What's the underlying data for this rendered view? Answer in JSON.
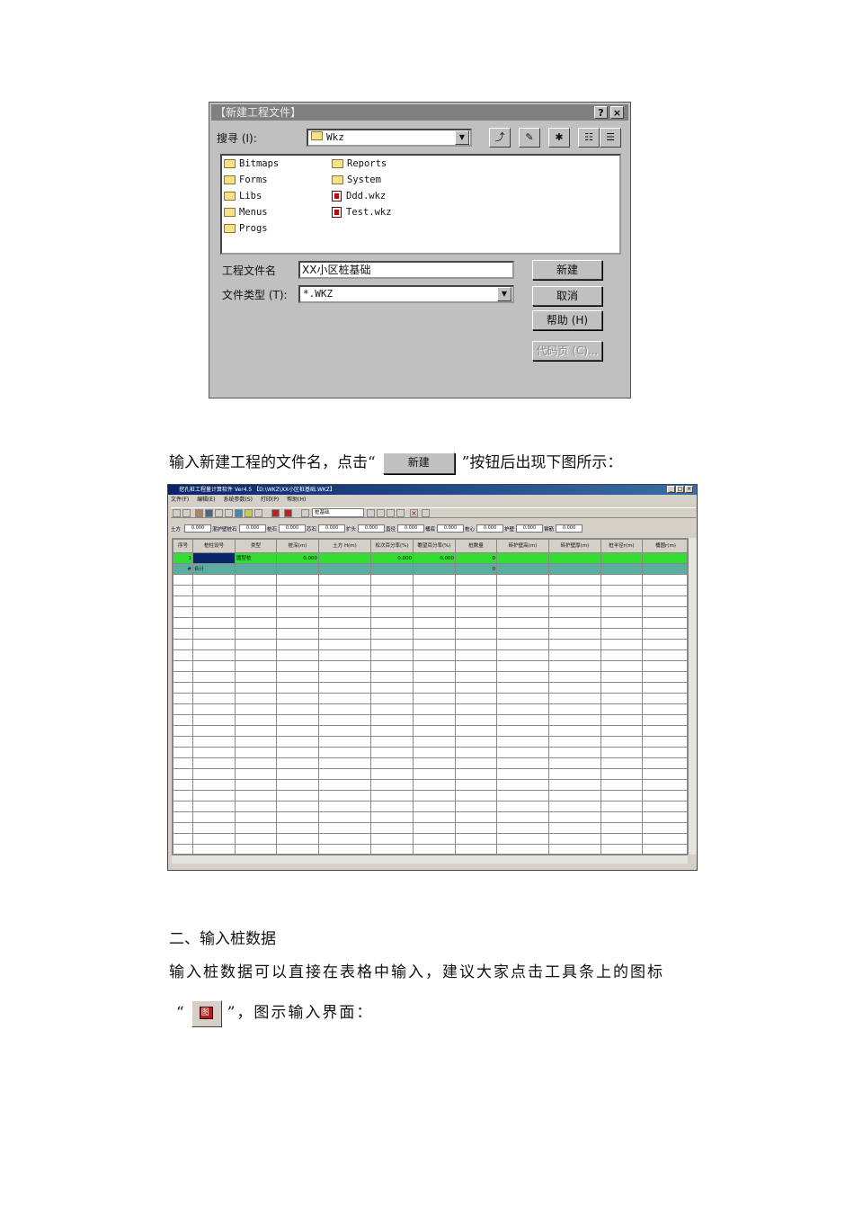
{
  "dialog": {
    "title": "【新建工程文件】",
    "help_btn": "?",
    "close_btn": "×",
    "search_label": "搜寻 (I):",
    "search_folder": "Wkz",
    "files_col1": [
      "Bitmaps",
      "Forms",
      "Libs",
      "Menus",
      "Progs"
    ],
    "files_col2": [
      {
        "name": "Reports",
        "type": "folder"
      },
      {
        "name": "System",
        "type": "folder"
      },
      {
        "name": "Ddd.wkz",
        "type": "wkz"
      },
      {
        "name": "Test.wkz",
        "type": "wkz"
      }
    ],
    "filename_label": "工程文件名",
    "filename_value": "XX小区桩基础",
    "filetype_label": "文件类型 (T):",
    "filetype_value": "*.WKZ",
    "buttons": {
      "new": "新建",
      "cancel": "取消",
      "help": "帮助 (H)",
      "codepage": "代码页 (C)..."
    }
  },
  "para1": {
    "before": "输入新建工程的文件名，点击“",
    "button": "新建",
    "after": "”按钮后出现下图所示："
  },
  "app": {
    "title": "挖孔桩工程量计算软件 Ver4.5      【D:\\WKZ\\XX小区桩基础.WKZ】",
    "menu": [
      "文件(F)",
      "编辑(E)",
      "系统参数(S)",
      "打印(P)",
      "帮助(H)"
    ],
    "toolbar_combo": "桩基础",
    "params": [
      {
        "label": "土方",
        "value": "0.000"
      },
      {
        "label": "混护壁桩石",
        "value": "0.000"
      },
      {
        "label": "桩石",
        "value": "0.000"
      },
      {
        "label": "芯石",
        "value": "0.000"
      },
      {
        "label": "扩头",
        "value": "0.000"
      },
      {
        "label": "直径",
        "value": "0.000"
      },
      {
        "label": "桶底",
        "value": "0.000"
      },
      {
        "label": "桩心",
        "value": "0.000"
      },
      {
        "label": "护壁",
        "value": "0.000"
      },
      {
        "label": "钢筋",
        "value": "0.000"
      }
    ],
    "columns": [
      "序号",
      "桩柱设号",
      "类型",
      "桩深(m)",
      "土方 H(m)",
      "松次百分率(%)",
      "瞻望百分率(%)",
      "桩数量",
      "砖护壁高(m)",
      "砖护壁厚(m)",
      "桩半径r(m)",
      "桶圆r(m)"
    ],
    "rows": [
      {
        "no": "1",
        "id": "",
        "type": "圆型桩",
        "depth": "0.000",
        "earth": "",
        "pct1": "0.000",
        "pct2": "0.000",
        "count": "0"
      },
      {
        "no": "#",
        "id": "合计",
        "type": "",
        "depth": "",
        "earth": "",
        "pct1": "",
        "pct2": "",
        "count": "0"
      }
    ]
  },
  "section2": {
    "heading": "二、输入桩数据",
    "line1": "输入桩数据可以直接在表格中输入，建议大家点击工具条上的图标",
    "line2_before": "“",
    "icon_glyph": "图",
    "line2_after": "”，图示输入界面："
  }
}
